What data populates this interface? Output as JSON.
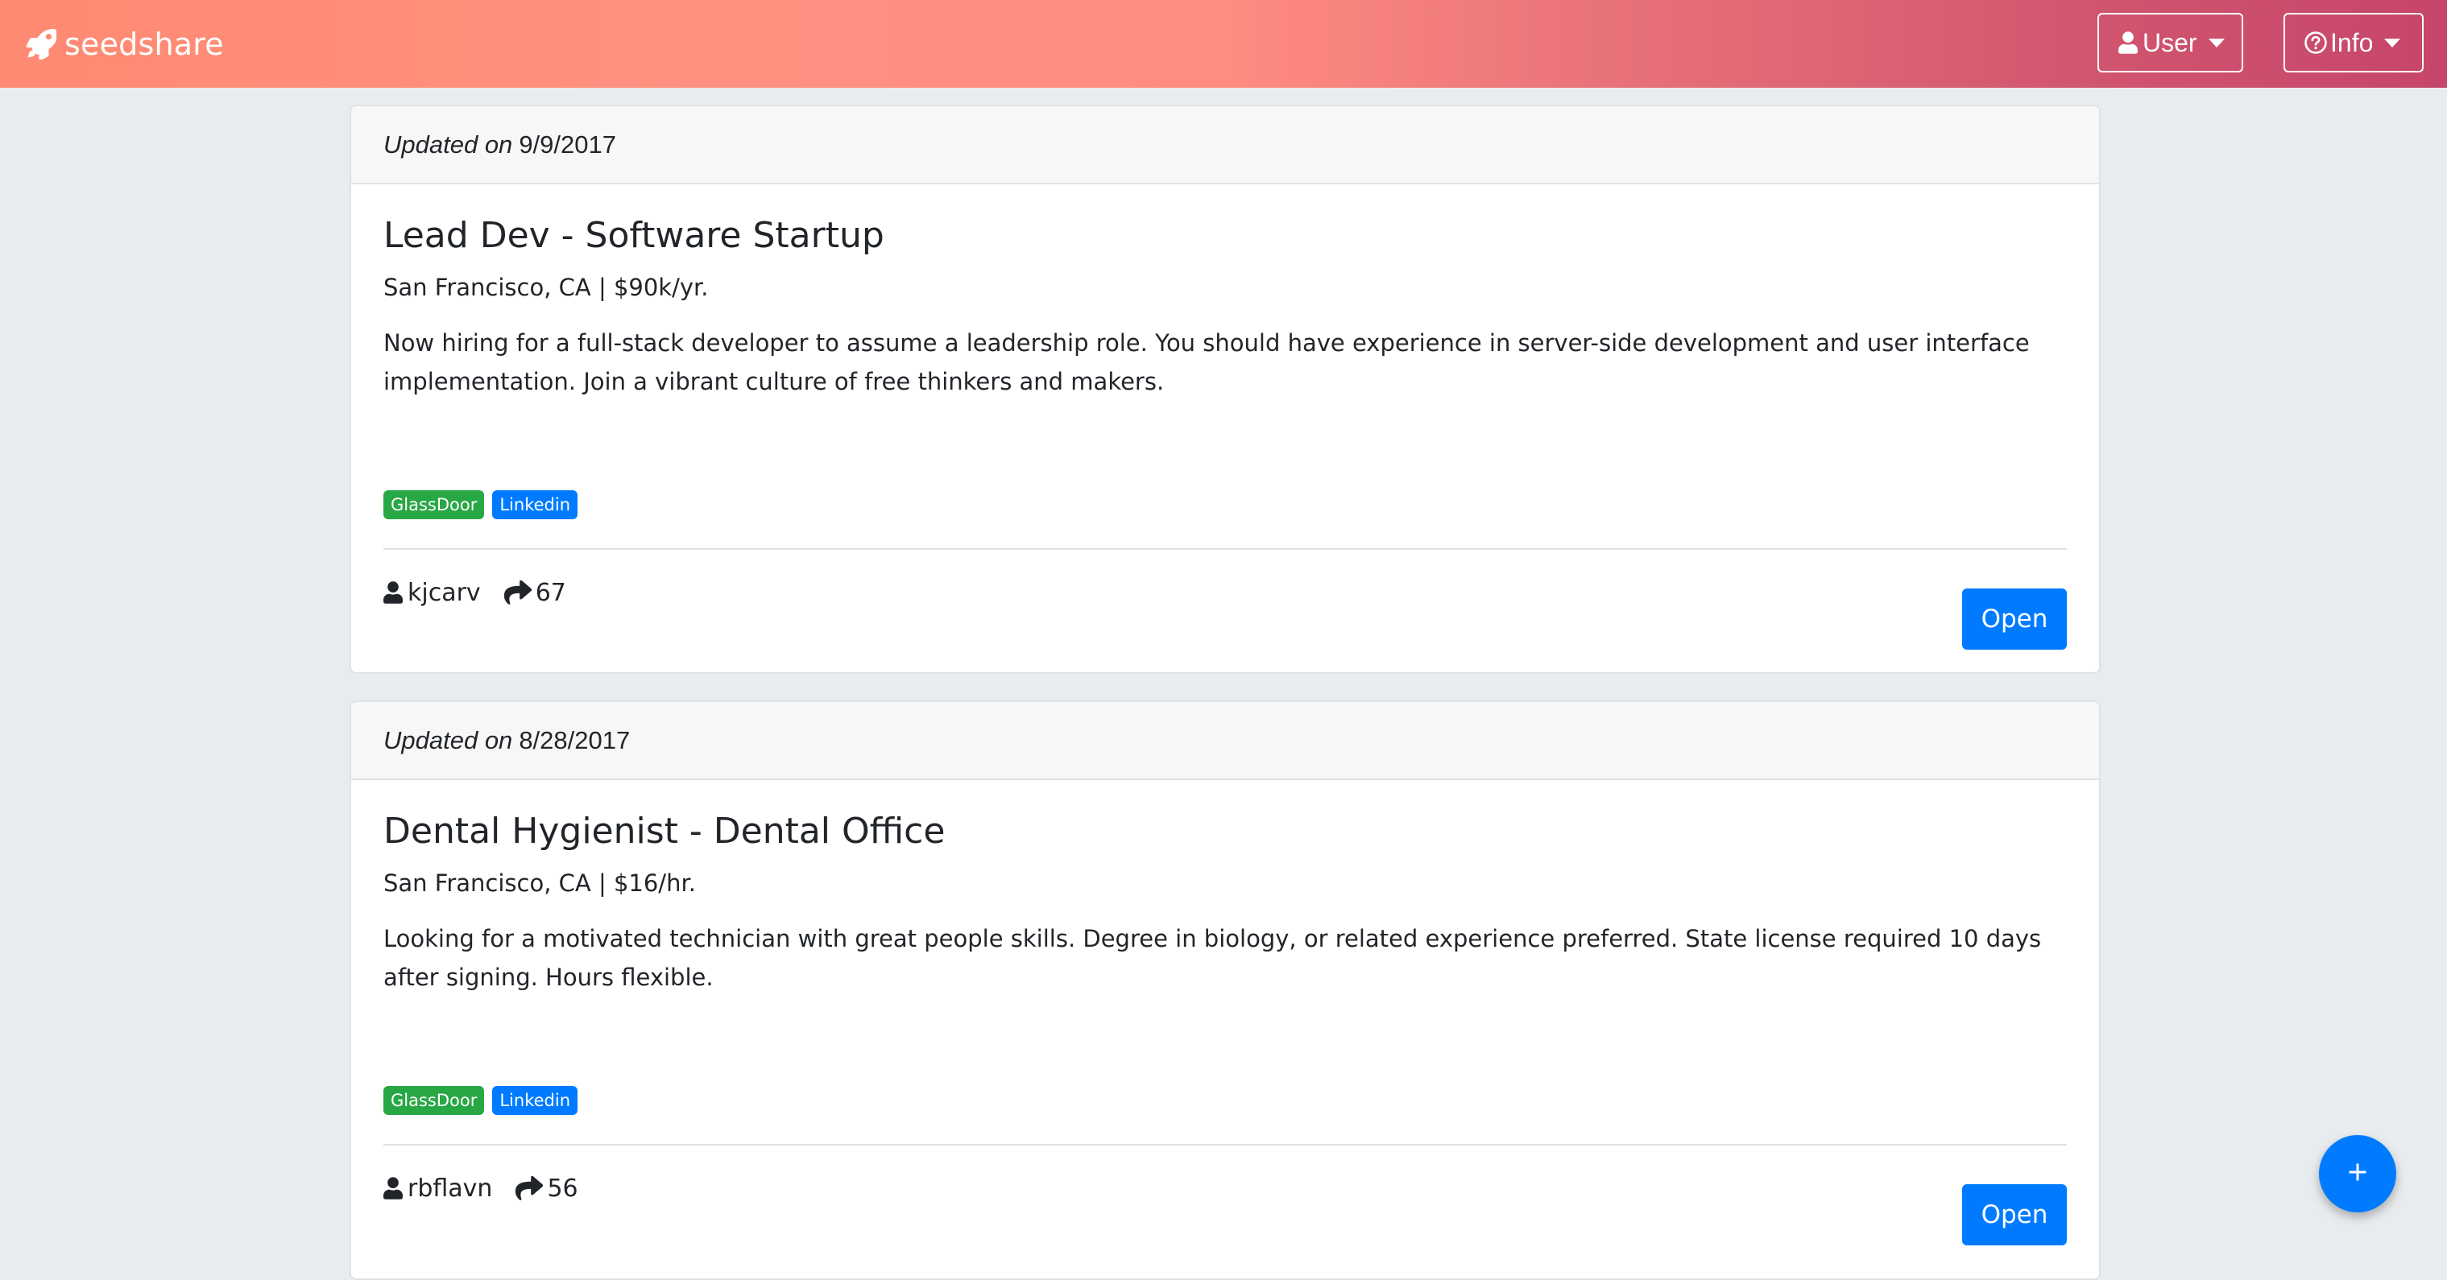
{
  "navbar": {
    "brand": "seedshare",
    "brand_icon": "rocket-icon",
    "user_button": "User",
    "info_button": "Info",
    "colors": {
      "gradient_start": "#ff8a73",
      "gradient_end": "#c6456a"
    }
  },
  "jobs": [
    {
      "updated_prefix": "Updated on",
      "updated_date": "9/9/2017",
      "title": "Lead Dev - Software Startup",
      "meta": "San Francisco, CA | $90k/yr.",
      "description": "Now hiring for a full-stack developer to assume a leadership role. You should have experience in server-side development and user interface implementation. Join a vibrant culture of free thinkers and makers.",
      "tags": [
        "GlassDoor",
        "Linkedin"
      ],
      "author": "kjcarv",
      "shares": "67",
      "open_label": "Open"
    },
    {
      "updated_prefix": "Updated on",
      "updated_date": "8/28/2017",
      "title": "Dental Hygienist - Dental Office",
      "meta": "San Francisco, CA | $16/hr.",
      "description": "Looking for a motivated technician with great people skills. Degree in biology, or related experience preferred. State license required 10 days after signing. Hours flexible.",
      "tags": [
        "GlassDoor",
        "Linkedin"
      ],
      "author": "rbflavn",
      "shares": "56",
      "open_label": "Open"
    }
  ],
  "fab": {
    "label": "+",
    "icon": "plus-icon"
  },
  "colors": {
    "primary": "#007bff",
    "success": "#28a745",
    "background": "#e9ecef"
  }
}
